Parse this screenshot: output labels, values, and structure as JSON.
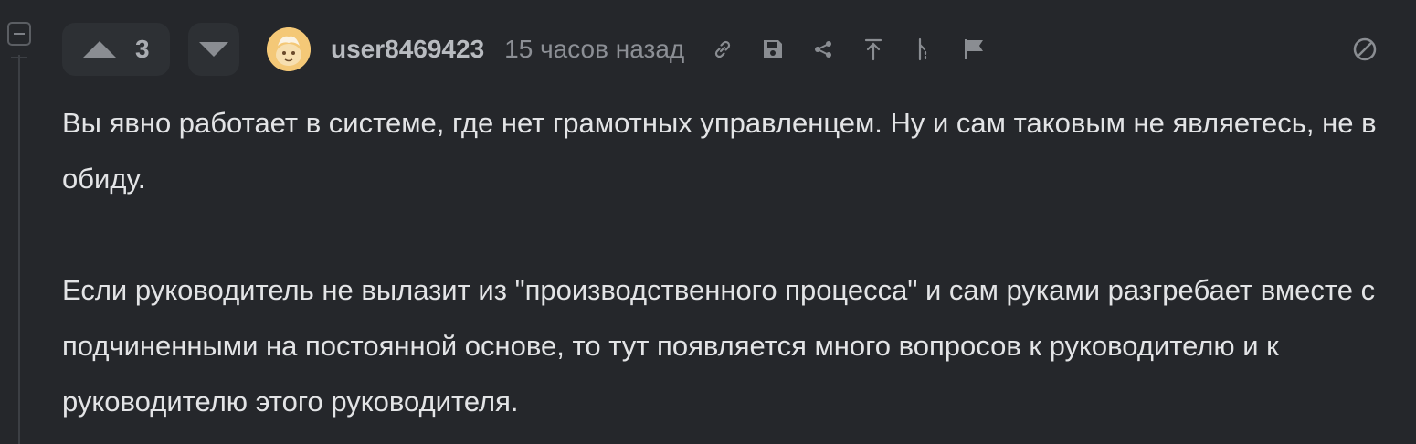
{
  "comment": {
    "vote_count": "3",
    "username": "user8469423",
    "timestamp": "15 часов назад",
    "paragraphs": [
      "Вы явно работает в системе, где нет грамотных управленцем. Ну и сам таковым не являетесь, не в обиду.",
      "Если руководитель не вылазит из \"производственного процесса\" и сам руками разгребает вместе с подчиненными на постоянной основе, то тут появляется много вопросов к руководителю и к руководителю этого руководителя."
    ]
  },
  "icons": {
    "collapse": "minus-square-icon",
    "upvote": "triangle-up-icon",
    "downvote": "triangle-down-icon",
    "avatar": "avatar-image",
    "actions": [
      "link-icon",
      "save-icon",
      "share-icon",
      "jump-to-parent-icon",
      "thread-icon",
      "flag-icon"
    ],
    "block": "block-icon"
  },
  "colors": {
    "background": "#25272b",
    "vote_bg": "#2d3034",
    "icon": "#8a8d92",
    "text": "#e3e4e6",
    "username": "#b8bbc0",
    "muted": "#8c8f95",
    "avatar_bg": "#f2c26b"
  }
}
